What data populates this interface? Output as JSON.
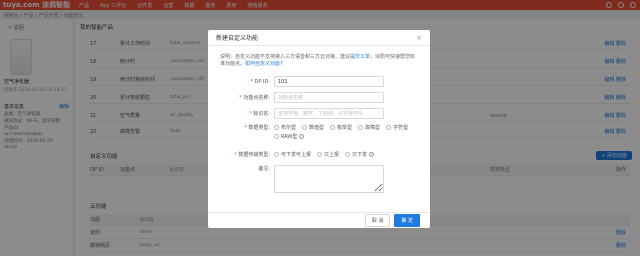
{
  "topbar": {
    "logo": "tuya.com 涂鸦智能",
    "nav": [
      "产品",
      "App 工作台",
      "云开发",
      "运营",
      "数据",
      "服务",
      "费用",
      "增值服务"
    ]
  },
  "breadcrumb": "控制台 / 产品 / 产品开发 / 功能定义",
  "left": {
    "back": "< 返回",
    "product_name": "空气净化器",
    "created": "创建于 2020-05-29 16:18:27",
    "info_title": "基本信息",
    "edit_label": "编辑",
    "info_lines": [
      "品类：空气净化器",
      "通讯协议：Wi-Fi、蓝牙双模",
      "产品ID：",
      "ia77ze6rnqxqbbz",
      "创建时间：2020-05-29",
      "16:18"
    ]
  },
  "main": {
    "section1": "我的智能产品",
    "rows": [
      {
        "id": "17",
        "name": "累计工作时间",
        "code": "total_runtime",
        "range": "",
        "action": "编辑 删除"
      },
      {
        "id": "18",
        "name": "倒计时",
        "code": "countdown_set",
        "range": "",
        "action": "编辑 删除"
      },
      {
        "id": "19",
        "name": "倒计时剩余时间",
        "code": "countdown_left",
        "range": "",
        "action": "编辑 删除"
      },
      {
        "id": "20",
        "name": "累计吸收颗粒",
        "code": "total_pm",
        "range": "",
        "action": "编辑 删除"
      },
      {
        "id": "21",
        "name": "空气质量",
        "code": "air_quality",
        "range": "severe",
        "action": "编辑 删除"
      },
      {
        "id": "22",
        "name": "故障告警",
        "code": "fault",
        "range": "",
        "action": "编辑 删除"
      }
    ],
    "section2": "自定义功能",
    "add_button": "+ 添加功能",
    "table_head": {
      "id": "DP ID",
      "name": "功能点",
      "code": "标识符",
      "type": "数据类型",
      "action": "操作"
    },
    "section3": "云功能",
    "cloud_head": {
      "name": "功能",
      "code": "标识符"
    },
    "cloud_rows": [
      {
        "name": "定时",
        "code": "timer",
        "action": "删除"
      },
      {
        "name": "跳转网页",
        "code": "jump_url",
        "action": "删除"
      }
    ]
  },
  "modal": {
    "title": "新建自定义功能",
    "close": "×",
    "desc_text": "说明：自定义功能不支持接入三方语音和三方云对接。建议",
    "desc_link1": "提交工单",
    "desc_text2": "，涂鸦可快速帮您标准功能点。",
    "desc_link2": "如何自定义功能?",
    "fields": {
      "dp_id": {
        "label": "DP ID:",
        "value": "101"
      },
      "name": {
        "label": "功能点名称:",
        "placeholder": "功能点名称"
      },
      "code": {
        "label": "标识名:",
        "placeholder": "支持字母、数字、下划线，以字母开头"
      },
      "data_type": {
        "label": "数据类型:",
        "options": [
          "布尔型",
          "数值型",
          "枚举型",
          "故障型",
          "字符型",
          "RAW型"
        ]
      },
      "transfer": {
        "label": "数据传输类型:",
        "options": [
          "可下发可上报",
          "只上报",
          "只下发"
        ]
      },
      "remark": {
        "label": "备注:"
      }
    },
    "cancel": "取 消",
    "ok": "确 定"
  }
}
